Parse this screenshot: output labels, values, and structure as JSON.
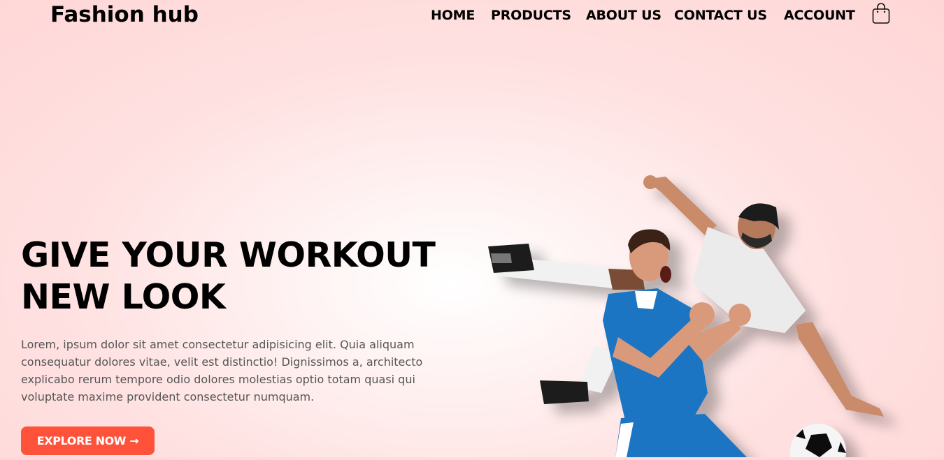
{
  "header": {
    "logo_text": "Fashion hub",
    "nav": [
      {
        "label": "HOME"
      },
      {
        "label": "PRODUCTS"
      },
      {
        "label": "ABOUT US"
      },
      {
        "label": "CONTACT US"
      },
      {
        "label": "ACCOUNT"
      }
    ],
    "cart_icon": "shopping-bag-icon"
  },
  "hero": {
    "title_line1": "GIVE YOUR WORKOUT",
    "title_line2": "NEW LOOK",
    "description": "Lorem, ipsum dolor sit amet consectetur adipisicing elit. Quia aliquam consequatur dolores vitae, velit est distinctio! Dignissimos a, architecto explicabo rerum tempore odio dolores molestias optio totam quasi qui voluptate maxime provident consectetur numquam.",
    "cta_label": "EXPLORE NOW →",
    "image_subject": "two soccer players"
  },
  "colors": {
    "accent": "#ff523b",
    "background": "#ffe1e1"
  }
}
